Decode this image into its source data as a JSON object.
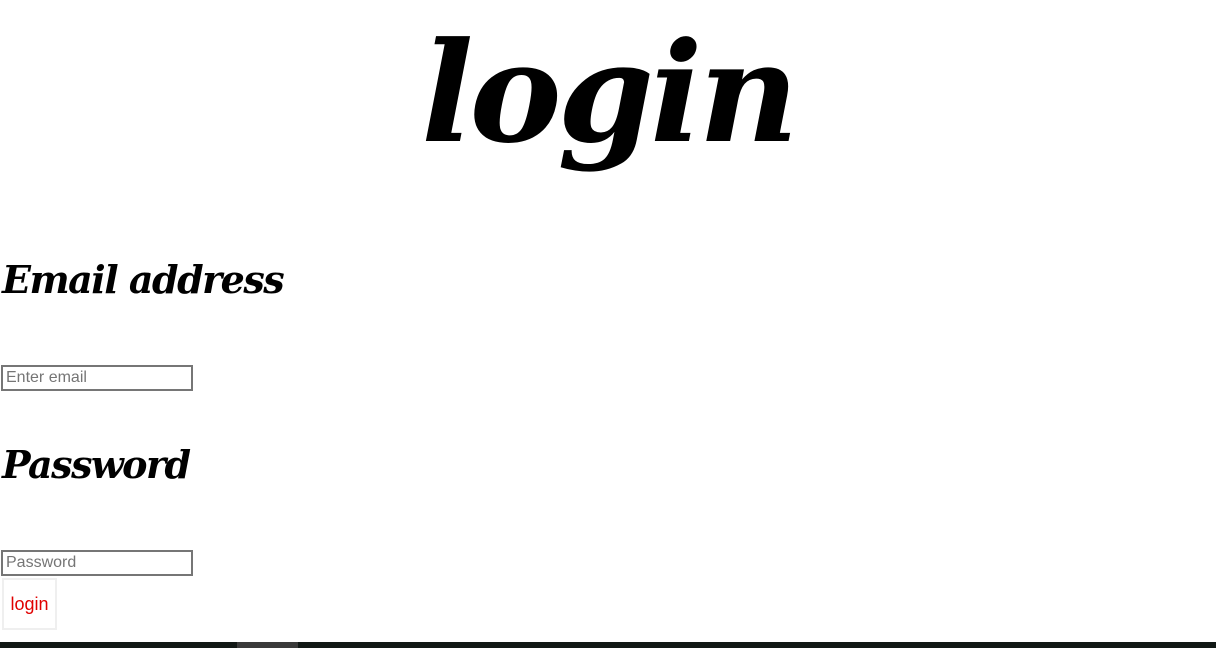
{
  "header": {
    "title": "login"
  },
  "form": {
    "email": {
      "label": "Email address",
      "placeholder": "Enter email",
      "value": ""
    },
    "password": {
      "label": "Password",
      "placeholder": "Password",
      "value": ""
    },
    "submit_label": "login"
  },
  "colors": {
    "background": "#ffffff",
    "text": "#000000",
    "button_text": "#e00000",
    "bottom_bar": "#111815"
  }
}
